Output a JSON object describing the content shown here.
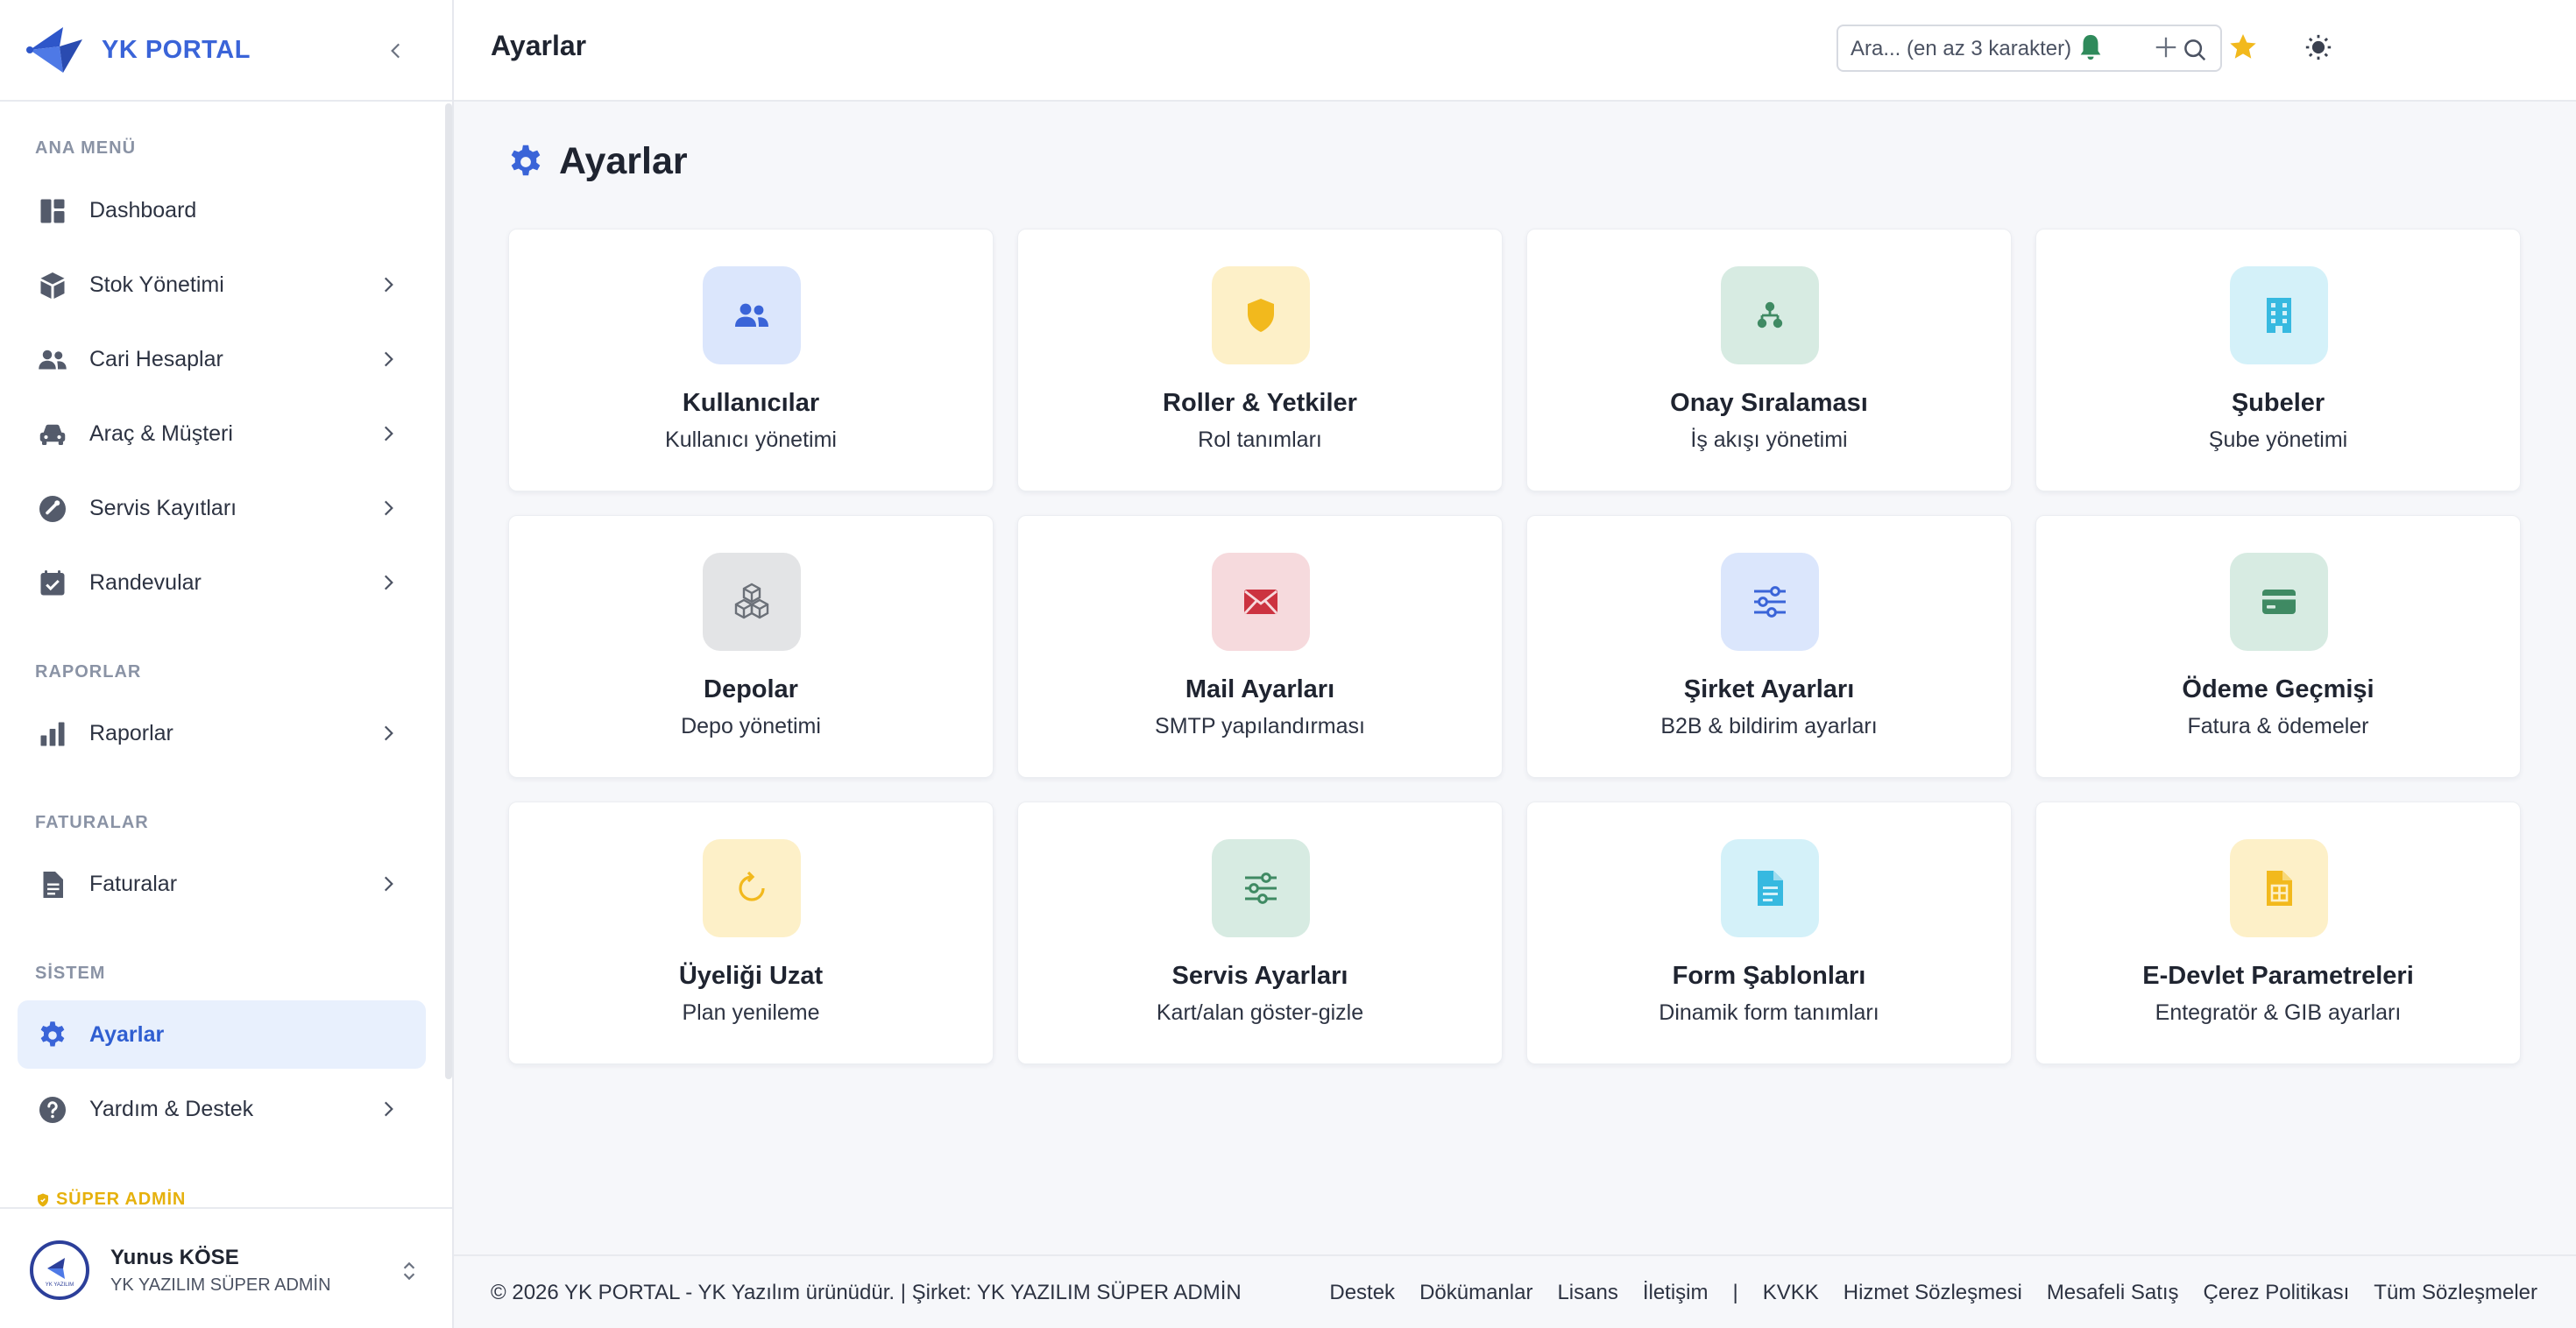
{
  "brand": {
    "name": "YK PORTAL"
  },
  "header": {
    "title": "Ayarlar",
    "search_placeholder": "Ara... (en az 3 karakter)"
  },
  "sidebar": {
    "sections": {
      "main": "ANA MENÜ",
      "reports": "RAPORLAR",
      "invoices": "FATURALAR",
      "system": "SİSTEM",
      "super_admin": "SÜPER ADMİN"
    },
    "items": [
      {
        "label": "Dashboard",
        "icon": "dashboard-icon"
      },
      {
        "label": "Stok Yönetimi",
        "icon": "box-icon"
      },
      {
        "label": "Cari Hesaplar",
        "icon": "users-icon"
      },
      {
        "label": "Araç & Müşteri",
        "icon": "car-icon"
      },
      {
        "label": "Servis Kayıtları",
        "icon": "service-icon"
      },
      {
        "label": "Randevular",
        "icon": "calendar-check-icon"
      },
      {
        "label": "Raporlar",
        "icon": "bar-chart-icon"
      },
      {
        "label": "Faturalar",
        "icon": "document-icon"
      },
      {
        "label": "Ayarlar",
        "icon": "gear-icon"
      },
      {
        "label": "Yardım & Destek",
        "icon": "help-icon"
      }
    ],
    "user": {
      "name": "Yunus KÖSE",
      "role": "YK YAZILIM SÜPER ADMİN",
      "avatar_text": "YK YAZILIM"
    }
  },
  "page": {
    "heading": "Ayarlar"
  },
  "cards": [
    {
      "title": "Kullanıcılar",
      "subtitle": "Kullanıcı yönetimi",
      "icon": "users-icon",
      "bg": "#dbe6fc",
      "fg": "#3a64d8"
    },
    {
      "title": "Roller & Yetkiler",
      "subtitle": "Rol tanımları",
      "icon": "shield-icon",
      "bg": "#fdf0c8",
      "fg": "#f2b91d"
    },
    {
      "title": "Onay Sıralaması",
      "subtitle": "İş akışı yönetimi",
      "icon": "hierarchy-icon",
      "bg": "#d7ebe2",
      "fg": "#3f8a63"
    },
    {
      "title": "Şubeler",
      "subtitle": "Şube yönetimi",
      "icon": "building-icon",
      "bg": "#d4f1f9",
      "fg": "#36b9e0"
    },
    {
      "title": "Depolar",
      "subtitle": "Depo yönetimi",
      "icon": "boxes-icon",
      "bg": "#e3e4e6",
      "fg": "#6b7078"
    },
    {
      "title": "Mail Ayarları",
      "subtitle": "SMTP yapılandırması",
      "icon": "envelope-icon",
      "bg": "#f6dadd",
      "fg": "#cc3340"
    },
    {
      "title": "Şirket Ayarları",
      "subtitle": "B2B & bildirim ayarları",
      "icon": "sliders-icon",
      "bg": "#dbe6fc",
      "fg": "#3a64d8"
    },
    {
      "title": "Ödeme Geçmişi",
      "subtitle": "Fatura & ödemeler",
      "icon": "credit-card-icon",
      "bg": "#d7ebe2",
      "fg": "#3f8a63"
    },
    {
      "title": "Üyeliği Uzat",
      "subtitle": "Plan yenileme",
      "icon": "refresh-icon",
      "bg": "#fdf0c8",
      "fg": "#f2b91d"
    },
    {
      "title": "Servis Ayarları",
      "subtitle": "Kart/alan göster-gizle",
      "icon": "sliders-icon",
      "bg": "#d7ebe2",
      "fg": "#3f8a63"
    },
    {
      "title": "Form Şablonları",
      "subtitle": "Dinamik form tanımları",
      "icon": "file-icon",
      "bg": "#d4f1f9",
      "fg": "#36b9e0"
    },
    {
      "title": "E-Devlet Parametreleri",
      "subtitle": "Entegratör & GIB ayarları",
      "icon": "spreadsheet-icon",
      "bg": "#fdf0c8",
      "fg": "#f2b91d"
    }
  ],
  "footer": {
    "copyright": "© 2026 YK PORTAL - YK Yazılım ürünüdür. | Şirket: YK YAZILIM SÜPER ADMİN",
    "links": [
      "Destek",
      "Dökümanlar",
      "Lisans",
      "İletişim",
      "|",
      "KVKK",
      "Hizmet Sözleşmesi",
      "Mesafeli Satış",
      "Çerez Politikası",
      "Tüm Sözleşmeler"
    ]
  },
  "colors": {
    "accent": "#3a64d8",
    "bell": "#2f8a5b",
    "star": "#f2b91d",
    "super_admin": "#e6b10d"
  }
}
